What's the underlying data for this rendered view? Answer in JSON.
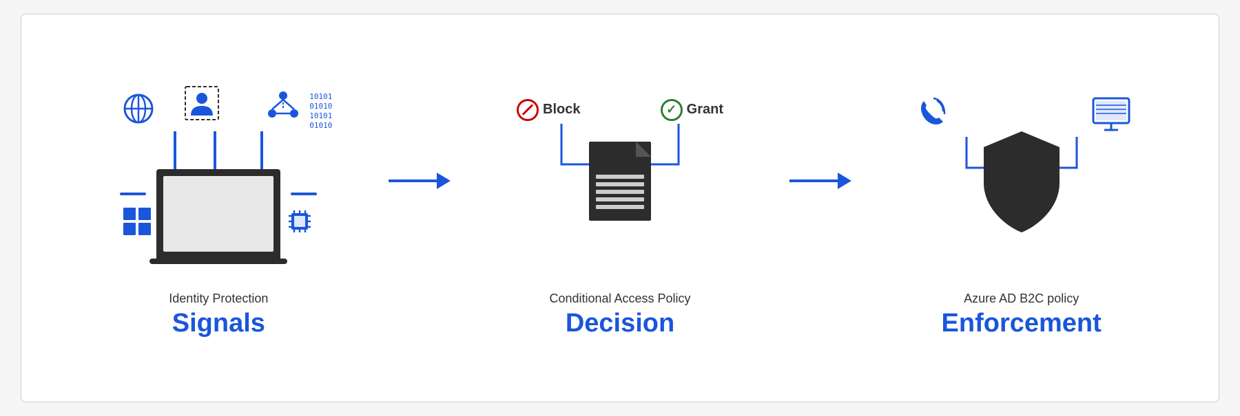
{
  "diagram": {
    "background": "#ffffff",
    "sections": [
      {
        "id": "signals",
        "sublabel": "Identity Protection",
        "mainlabel": "Signals"
      },
      {
        "id": "decision",
        "sublabel": "Conditional Access Policy",
        "mainlabel": "Decision",
        "block_label": "Block",
        "grant_label": "Grant"
      },
      {
        "id": "enforcement",
        "sublabel": "Azure AD B2C policy",
        "mainlabel": "Enforcement"
      }
    ],
    "colors": {
      "blue": "#1a56db",
      "dark": "#2c2c2c",
      "red": "#cc0000",
      "green": "#2e7d32"
    }
  }
}
